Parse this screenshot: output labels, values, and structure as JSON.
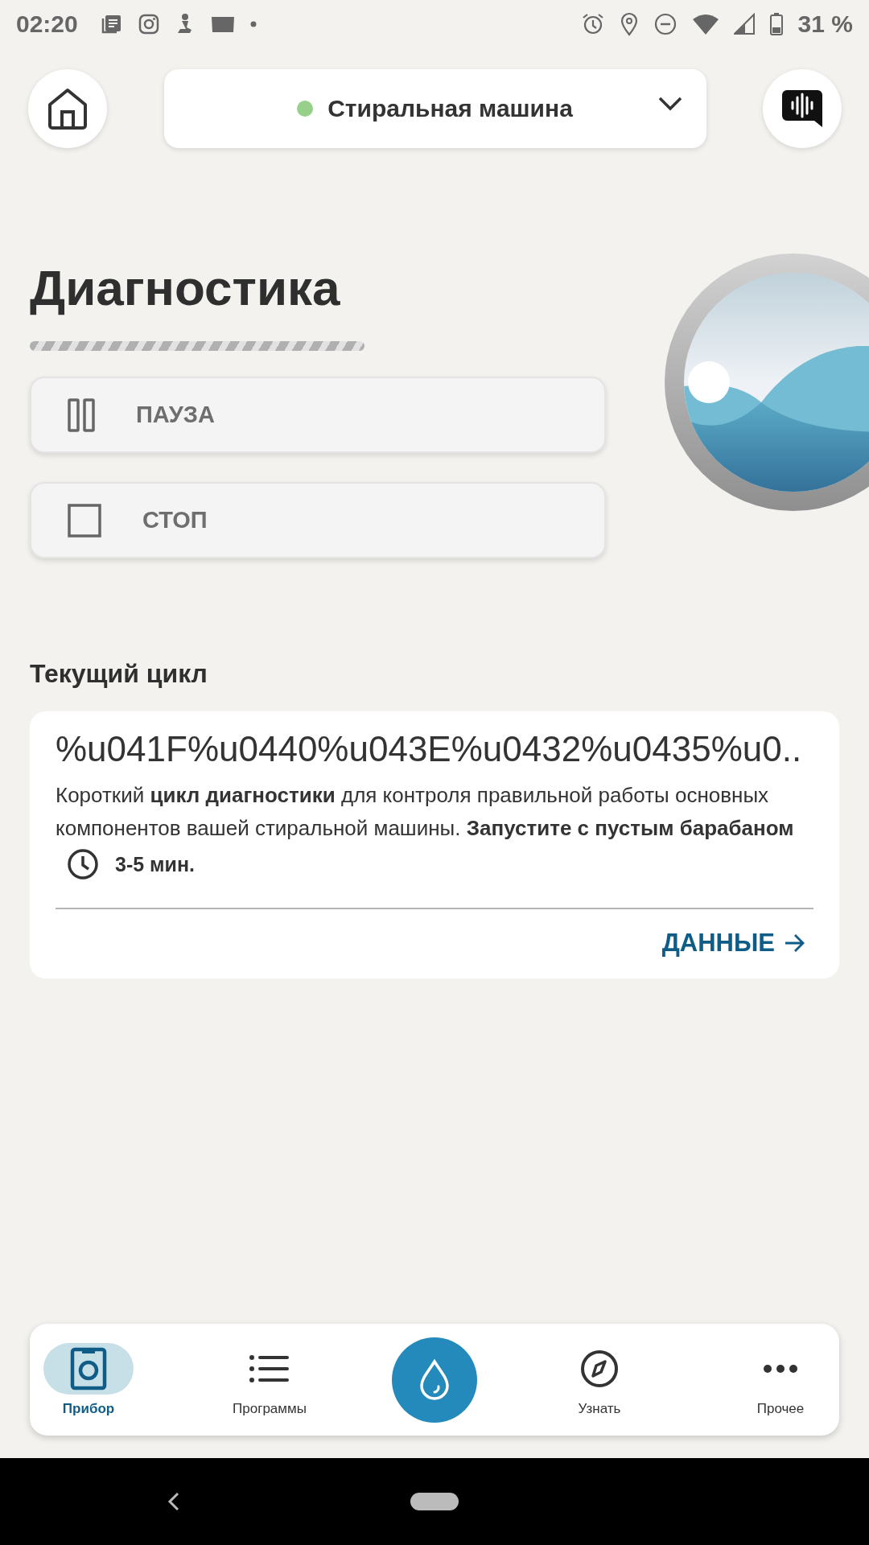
{
  "status_bar": {
    "time": "02:20",
    "battery": "31 %"
  },
  "header": {
    "appliance": {
      "name": "Стиральная машина",
      "online": true,
      "color": "#97d08a"
    }
  },
  "program": {
    "title": "Диагностика",
    "running": true
  },
  "controls": [
    {
      "kind": "pause",
      "label": "ПАУЗА",
      "disabled": false
    },
    {
      "kind": "stop",
      "label": "СТОП",
      "disabled": false
    }
  ],
  "section_title": "Текущий цикл",
  "cycle": {
    "title": "%u041F%u0440%u043E%u0432%u0435%u0..",
    "description": "Короткий **цикл диагностики** для контроля правильной работы основных компонентов вашей стиральной машины. **Запустите с пустым барабаном**",
    "duration": "3-5 мин.",
    "link": "ДАННЫЕ"
  },
  "bottom_nav": [
    {
      "kind": "device",
      "label": "Прибор",
      "selected": true
    },
    {
      "kind": "programs",
      "label": "Программы",
      "selected": false
    },
    {
      "kind": "action",
      "selected": false
    },
    {
      "kind": "learn",
      "label": "Узнать",
      "selected": false
    },
    {
      "kind": "more",
      "label": "Прочее",
      "selected": false
    }
  ]
}
